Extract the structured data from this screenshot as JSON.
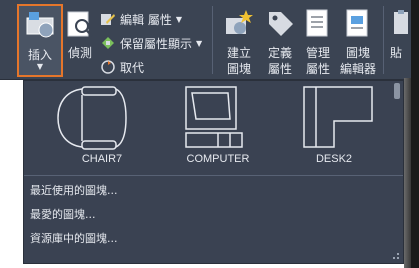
{
  "ribbon": {
    "insert": {
      "label": "插入"
    },
    "detect": {
      "label": "偵測"
    },
    "edit_attributes": {
      "label": "編輯 屬性"
    },
    "retain_attribute_display": {
      "label": "保留屬性顯示"
    },
    "replace": {
      "label": "取代"
    },
    "create_block": {
      "line1": "建立",
      "line2": "圖塊"
    },
    "define_attribute": {
      "line1": "定義",
      "line2": "屬性"
    },
    "manage_attributes": {
      "line1": "管理",
      "line2": "屬性"
    },
    "block_editor": {
      "line1": "圖塊",
      "line2": "編輯器"
    },
    "paste": {
      "label": "貼"
    }
  },
  "gallery": {
    "blocks": [
      {
        "name": "CHAIR7"
      },
      {
        "name": "COMPUTER"
      },
      {
        "name": "DESK2"
      }
    ],
    "menu": [
      {
        "label": "最近使用的圖塊..."
      },
      {
        "label": "最愛的圖塊..."
      },
      {
        "label": "資源庫中的圖塊..."
      }
    ]
  },
  "colors": {
    "ribbon_bg": "#3b4453",
    "panel_bg": "#3a4252",
    "highlight": "#e5762b",
    "text": "#e6e9ef"
  }
}
